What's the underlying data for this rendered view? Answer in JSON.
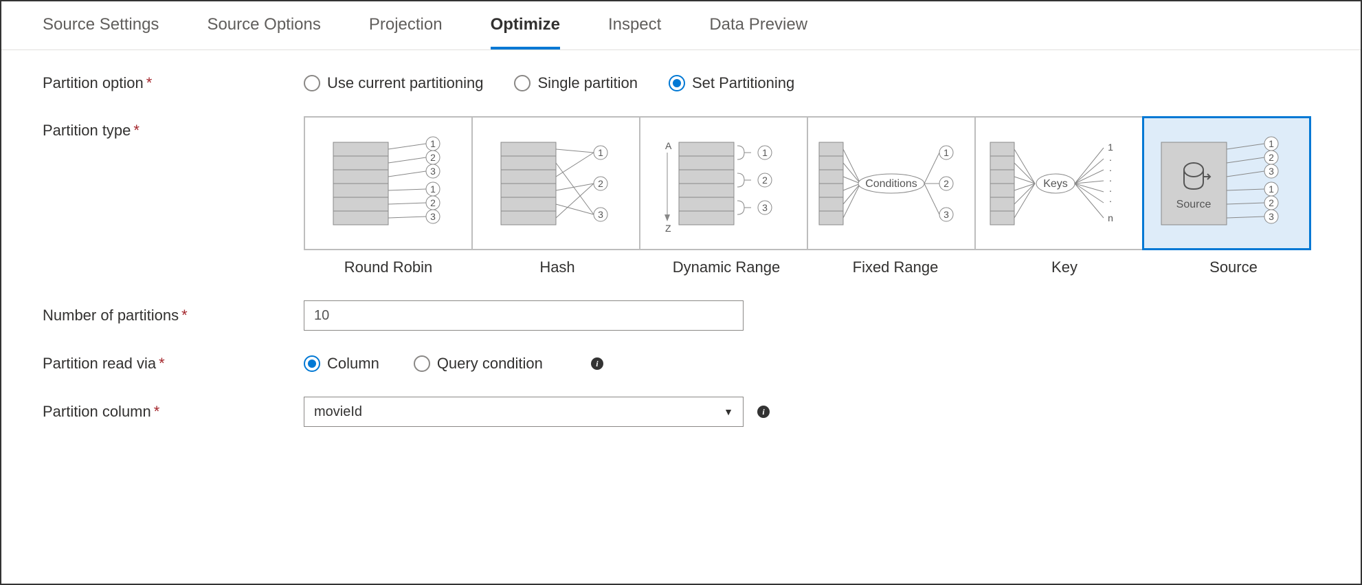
{
  "tabs": [
    {
      "label": "Source Settings",
      "active": false
    },
    {
      "label": "Source Options",
      "active": false
    },
    {
      "label": "Projection",
      "active": false
    },
    {
      "label": "Optimize",
      "active": true
    },
    {
      "label": "Inspect",
      "active": false
    },
    {
      "label": "Data Preview",
      "active": false
    }
  ],
  "labels": {
    "partition_option": "Partition option",
    "partition_type": "Partition type",
    "num_partitions": "Number of partitions",
    "partition_read_via": "Partition read via",
    "partition_column": "Partition column"
  },
  "partition_option": {
    "options": [
      {
        "label": "Use current partitioning",
        "selected": false
      },
      {
        "label": "Single partition",
        "selected": false
      },
      {
        "label": "Set Partitioning",
        "selected": true
      }
    ]
  },
  "partition_types": [
    {
      "label": "Round Robin",
      "selected": false
    },
    {
      "label": "Hash",
      "selected": false
    },
    {
      "label": "Dynamic Range",
      "selected": false
    },
    {
      "label": "Fixed Range",
      "selected": false
    },
    {
      "label": "Key",
      "selected": false
    },
    {
      "label": "Source",
      "selected": true
    }
  ],
  "num_partitions_value": "10",
  "partition_read_via": {
    "options": [
      {
        "label": "Column",
        "selected": true
      },
      {
        "label": "Query condition",
        "selected": false
      }
    ]
  },
  "partition_column_value": "movieId",
  "diagram": {
    "conditions_label": "Conditions",
    "keys_label": "Keys",
    "source_label": "Source"
  }
}
